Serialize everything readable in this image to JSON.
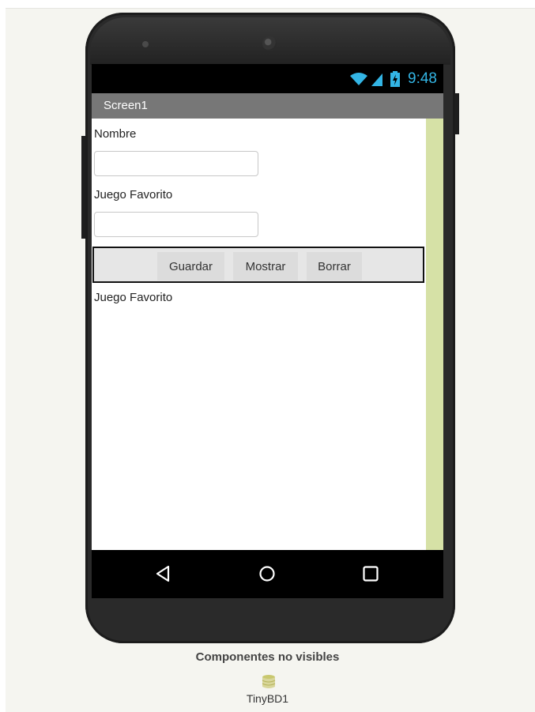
{
  "status_bar": {
    "time": "9:48",
    "icons": [
      "wifi-icon",
      "signal-icon",
      "battery-charging-icon"
    ],
    "accent": "#33b5e5"
  },
  "screen": {
    "title": "Screen1",
    "title_bar_color": "#777777"
  },
  "form": {
    "label_nombre": "Nombre",
    "input_nombre_value": "",
    "label_juego": "Juego Favorito",
    "input_juego_value": "",
    "buttons": {
      "guardar": "Guardar",
      "mostrar": "Mostrar",
      "borrar": "Borrar"
    },
    "result_label": "Juego Favorito"
  },
  "navigation": {
    "icons": [
      "back-icon",
      "home-icon",
      "recents-icon"
    ]
  },
  "non_visible": {
    "title": "Componentes no visibles",
    "components": [
      {
        "name": "TinyBD1",
        "icon": "database-icon"
      }
    ]
  },
  "colors": {
    "scroll_strip": "#d6e1a6",
    "phone_body": "#2a2a2a"
  }
}
